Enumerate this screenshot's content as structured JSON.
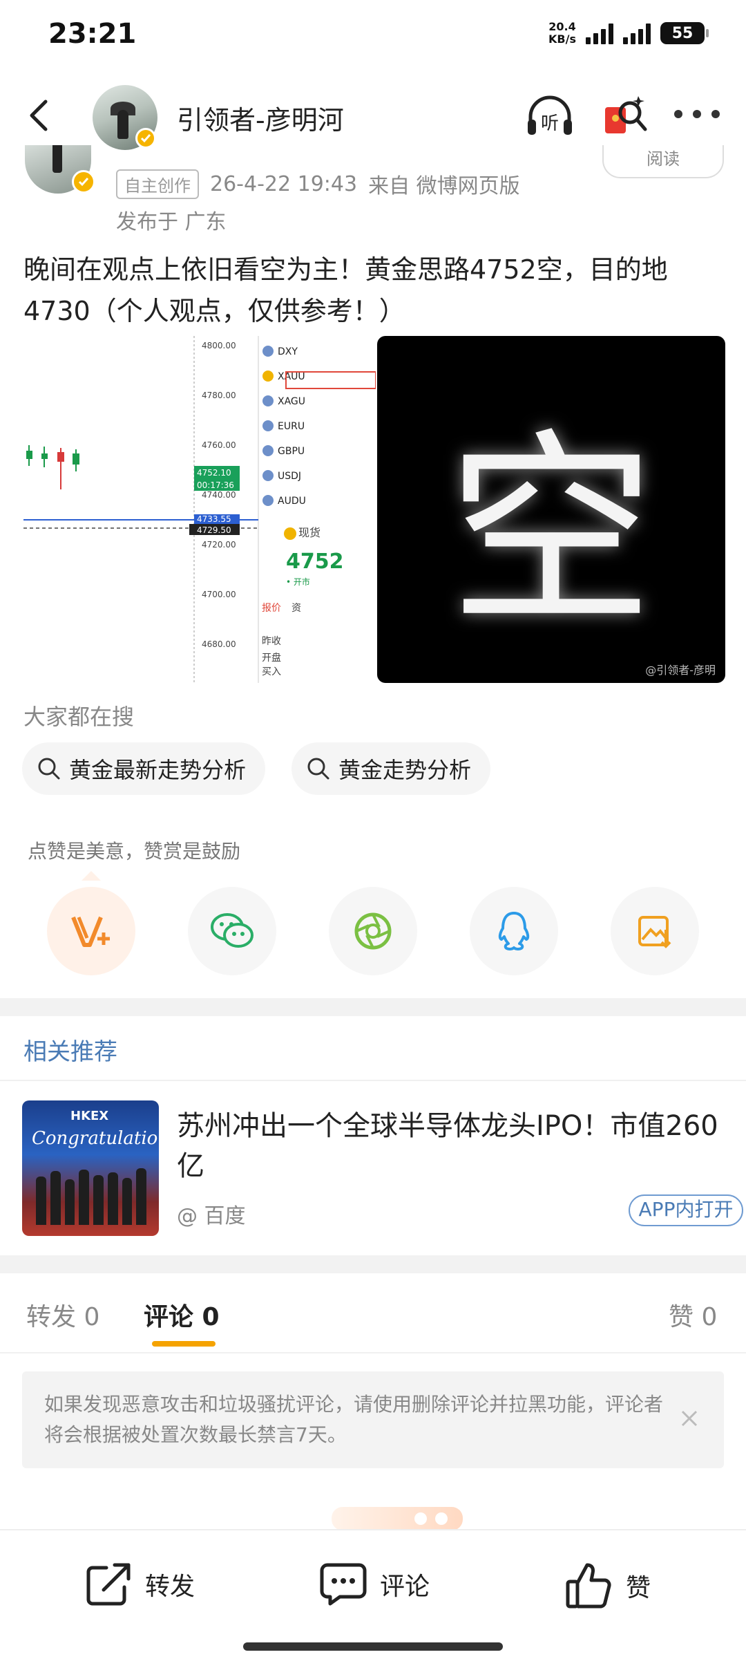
{
  "status_bar": {
    "time": "23:21",
    "net_speed_value": "20.4",
    "net_speed_unit": "KB/s",
    "battery": "55"
  },
  "header": {
    "user_name": "引领者-彦明河",
    "listen_label": "听"
  },
  "post": {
    "origin_tag": "自主创作",
    "datetime": "26-4-22 19:43",
    "source": "来自 微博网页版",
    "location": "发布于 广东",
    "read_label": "阅读",
    "text": "晚间在观点上依旧看空为主！黄金思路4752空，目的地4730（个人观点，仅供参考！）",
    "chart_image": {
      "price_levels": [
        "4800.00",
        "4780.00",
        "4760.00",
        "4740.00",
        "4720.00",
        "4700.00",
        "4680.00"
      ],
      "current_price": "4752.10",
      "countdown": "00:17:36",
      "line_price_1": "4733.55",
      "line_price_2": "4729.50",
      "symbols": [
        "DXY",
        "XAUU",
        "XAGU",
        "EURU",
        "GBPU",
        "USDJ",
        "AUDU"
      ],
      "spot_label": "现货",
      "big_price": "4752",
      "side_labels": [
        "报价",
        "资",
        "昨收",
        "开盘",
        "买入"
      ]
    },
    "overlay_image": {
      "character": "空",
      "watermark": "@引领者-彦明"
    }
  },
  "hot_search": {
    "title": "大家都在搜",
    "items": [
      "黄金最新走势分析",
      "黄金走势分析"
    ]
  },
  "reward": {
    "text": "点赞是美意，赞赏是鼓励"
  },
  "related": {
    "title": "相关推荐",
    "thumb_label_top": "HKEX",
    "thumb_label_mid": "Congratulations!",
    "headline": "苏州冲出一个全球半导体龙头IPO！市值260亿",
    "source": "@ 百度",
    "open_in_app": "APP内打开"
  },
  "tabs": {
    "repost": "转发 0",
    "comment": "评论 0",
    "like": "赞 0"
  },
  "notice": {
    "text": "如果发现恶意攻击和垃圾骚扰评论，请使用删除评论并拉黑功能，评论者将会根据被处置次数最长禁言7天。"
  },
  "bottom_bar": {
    "repost": "转发",
    "comment": "评论",
    "like": "赞"
  },
  "colors": {
    "accent": "#f5a300",
    "link_blue": "#4a7bb5",
    "verified": "#f6b400"
  }
}
